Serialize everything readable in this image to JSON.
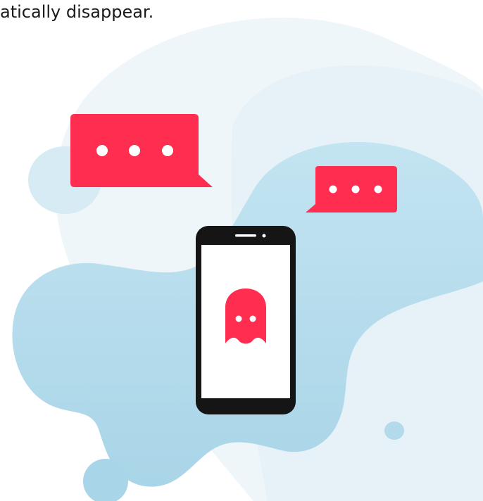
{
  "header": {
    "caption_text": "atically disappear."
  },
  "illustration": {
    "phone_icon": "ghost-icon",
    "chat_bubble_icon": "typing-dots-icon"
  },
  "colors": {
    "accent": "#FF2D4F",
    "phone_body": "#151515",
    "phone_screen": "#FFFFFF",
    "blob_light": "#EEF6FA",
    "blob_blue": "#BCE0EE"
  }
}
